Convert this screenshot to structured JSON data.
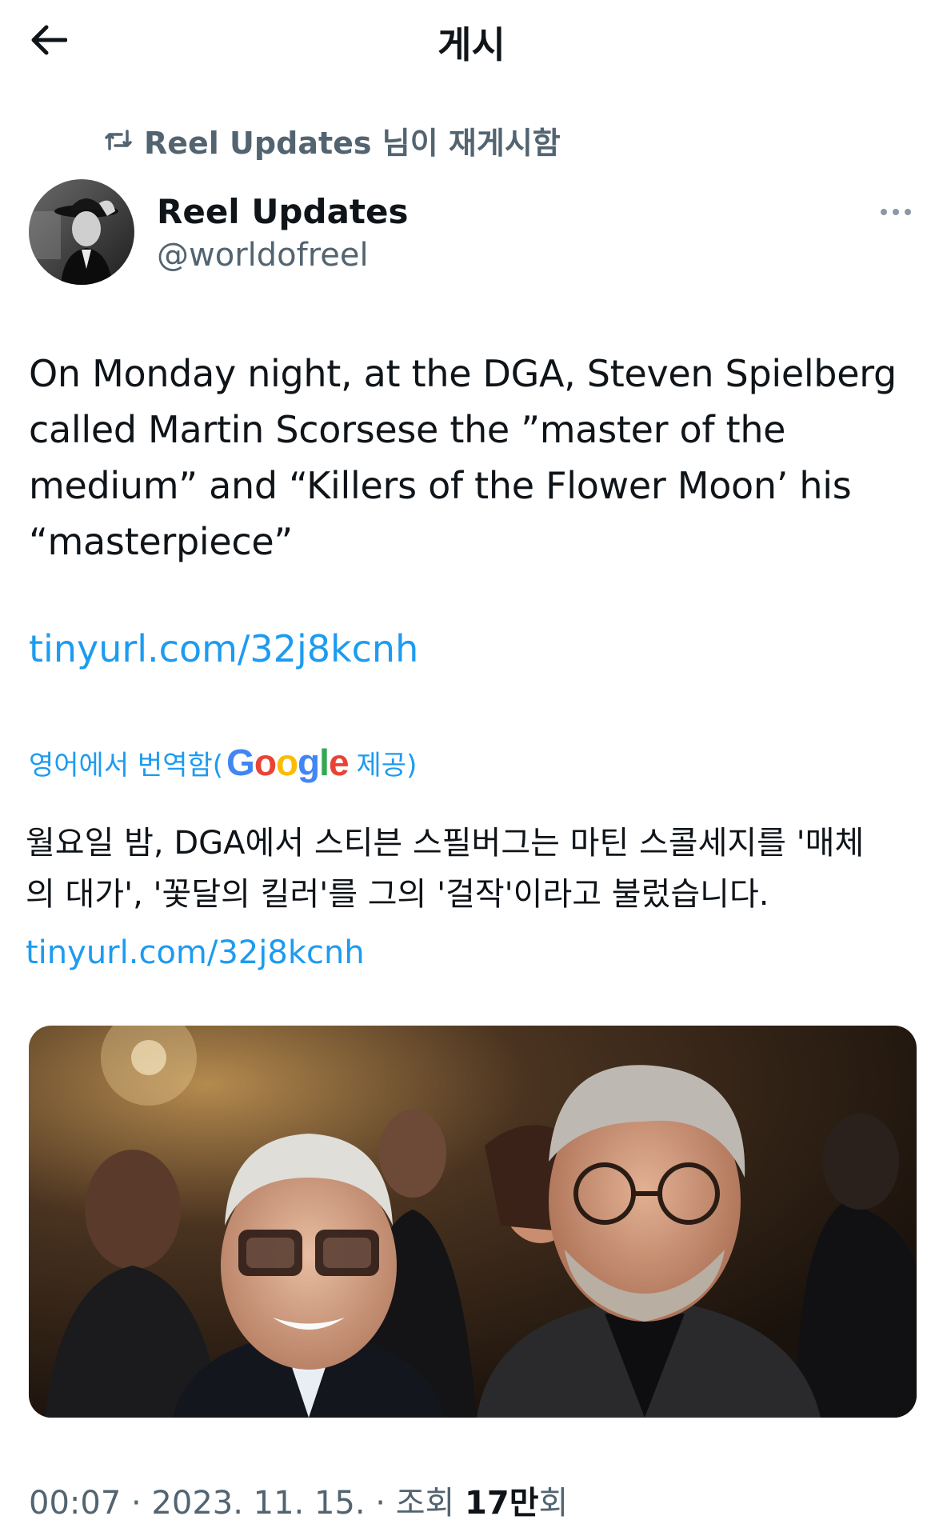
{
  "header": {
    "title": "게시"
  },
  "retweet": {
    "text": "Reel Updates 님이 재게시함"
  },
  "author": {
    "name": "Reel Updates",
    "handle": "@worldofreel"
  },
  "tweet": {
    "lines": [
      "On Monday night, at the DGA, Steven Spielberg",
      "called Martin Scorsese the ”master of the",
      "medium” and “Killers of the Flower Moon’ his",
      "“masterpiece”"
    ],
    "link": "tinyurl.com/32j8kcnh"
  },
  "translation": {
    "prefix": "영어에서 번역함(",
    "provider_letters": [
      "G",
      "o",
      "o",
      "g",
      "l",
      "e"
    ],
    "provider_colors": [
      "#4285F4",
      "#EA4335",
      "#FBBC05",
      "#4285F4",
      "#34A853",
      "#EA4335"
    ],
    "suffix": " 제공)",
    "lines": [
      "월요일 밤, DGA에서 스티븐 스필버그는 마틴 스콜세지를 '매체",
      "의 대가', '꽃달의 킬러'를 그의 '걸작'이라고 불렀습니다."
    ],
    "link": "tinyurl.com/32j8kcnh"
  },
  "meta": {
    "time": "00:07 · 2023. 11. 15. · 조회 ",
    "views": "17만",
    "views_suffix": "회"
  },
  "colors": {
    "text": "#0f1419",
    "secondary": "#536471",
    "link": "#1d9bf0"
  }
}
